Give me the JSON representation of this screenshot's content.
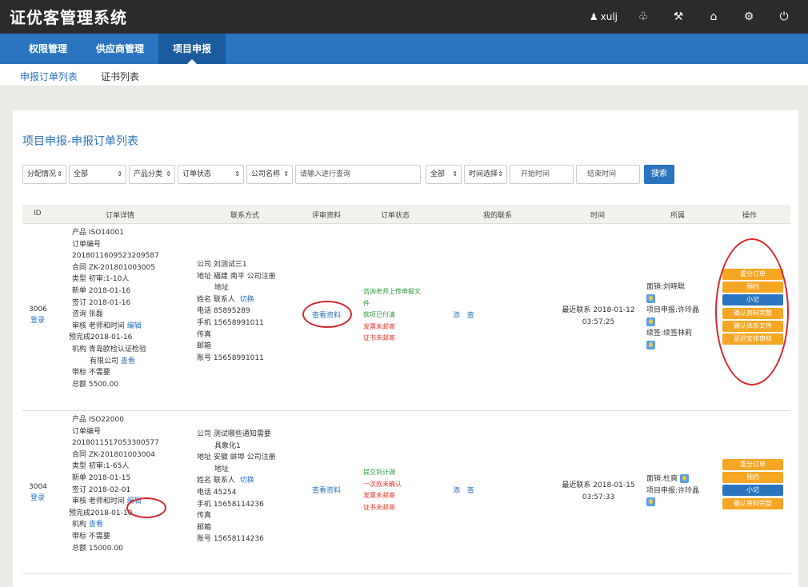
{
  "app": {
    "title": "证优客管理系统",
    "username": "xulj"
  },
  "topicons": [
    "bell-icon",
    "wrench-icon",
    "home-icon",
    "gear-icon",
    "power-icon"
  ],
  "nav": {
    "items": [
      "权限管理",
      "供应商管理",
      "项目申报"
    ],
    "active_index": 2
  },
  "subnav": {
    "items": [
      "申报订单列表",
      "证书列表"
    ],
    "active_index": 0
  },
  "page_title": "项目申报-申报订单列表",
  "filters": {
    "assign": "分配情况",
    "assign_value": "全部",
    "category": "产品分类",
    "order_status": "订单状态",
    "company_name": "公司名称",
    "search_placeholder": "请输入进行查询",
    "scope_value": "全部",
    "time_select": "时间选择",
    "start_time": "开始时间",
    "end_time": "结束时间",
    "search_button": "搜索"
  },
  "table": {
    "headers": [
      "ID",
      "订单详情",
      "联系方式",
      "评审资料",
      "订单状态",
      "我的联系",
      "时间",
      "所属",
      "操作"
    ],
    "rows": [
      {
        "id": "3006",
        "login": "登录",
        "details": {
          "product": "产品 ISO14001",
          "order_no_label": "订单编号",
          "order_no": "2018011609523209587",
          "contract": "合同 ZK-201801003005",
          "type": "类型 初审:1-10人",
          "new": "新单 2018-01-16",
          "signed": "签订 2018-01-16",
          "consult": "咨询 张磊",
          "review": "审核 老师和时间",
          "review_edit": "编辑",
          "predone": "预完成2018-01-16",
          "org": "机构 青岛欧检认证检验",
          "org2": "有限公司",
          "org_view": "查看",
          "bid": "带标 不需要",
          "total": "总额 5500.00"
        },
        "contact": {
          "company": "公司 刘测试三1",
          "address": "地址 福建 南平 公司注册",
          "address2": "地址",
          "name": "姓名 联系人",
          "switch": "切换",
          "phone": "电话 85895289",
          "mobile": "手机 15658991011",
          "fax": "传真",
          "email": "邮箱",
          "account": "账号 15658991011"
        },
        "review_link": "查看资料",
        "status": [
          {
            "text": "咨询老师上传申报文件",
            "color": "green"
          },
          {
            "text": "款项已付清",
            "color": "green"
          },
          {
            "text": "发票未邮寄",
            "color": "red"
          },
          {
            "text": "证书未邮寄",
            "color": "red"
          }
        ],
        "status_line1": "咨询老师上传申报文",
        "status_line1b": "件",
        "my_contact": {
          "add": "添",
          "view": "查"
        },
        "time": {
          "line1": "最近联系 2018-01-12",
          "line2": "03:57:25"
        },
        "owner": {
          "sales": "面销:刘晓聪",
          "project": "项目申报:许玲晶",
          "renew": "续签:续签林莉"
        },
        "ops": [
          {
            "label": "重分订单",
            "color": "orange"
          },
          {
            "label": "预约",
            "color": "orange"
          },
          {
            "label": "小记",
            "color": "blue"
          },
          {
            "label": "确认资料完整",
            "color": "orange"
          },
          {
            "label": "确认体系文件",
            "color": "orange"
          },
          {
            "label": "延迟安排审核",
            "color": "orange"
          }
        ]
      },
      {
        "id": "3004",
        "login": "登录",
        "details": {
          "product": "产品 ISO22000",
          "order_no_label": "订单编号",
          "order_no": "2018011517053300577",
          "contract": "合同 ZK-201801003004",
          "type": "类型 初审:1-65人",
          "new": "新单 2018-01-15",
          "signed": "签订 2018-02-01",
          "review": "审核 老师和时间",
          "review_edit": "编辑",
          "predone": "预完成2018-01-10",
          "org": "机构",
          "org_view": "查看",
          "bid": "带标 不需要",
          "total": "总额 15000.00"
        },
        "contact": {
          "company": "公司 测试哪些通知需要",
          "company2": "具象化1",
          "address": "地址 安徽 蚌埠 公司注册",
          "address2": "地址",
          "name": "姓名 联系人",
          "switch": "切换",
          "phone": "电话 45254",
          "mobile": "手机 15658114236",
          "fax": "传真",
          "email": "邮箱",
          "account": "账号 15658114236"
        },
        "review_link": "查看资料",
        "status": [
          {
            "text": "提交到计调",
            "color": "green"
          },
          {
            "text": "一次款未确认",
            "color": "red"
          },
          {
            "text": "发票未邮寄",
            "color": "red"
          },
          {
            "text": "证书未邮寄",
            "color": "red"
          }
        ],
        "my_contact": {
          "add": "添",
          "view": "查"
        },
        "time": {
          "line1": "最近联系 2018-01-15",
          "line2": "03:57:33"
        },
        "owner": {
          "sales": "面销:杜爽",
          "project": "项目申报:许玲晶"
        },
        "ops": [
          {
            "label": "重分订单",
            "color": "orange"
          },
          {
            "label": "预约",
            "color": "orange"
          },
          {
            "label": "小记",
            "color": "blue"
          },
          {
            "label": "确认资料完整",
            "color": "orange"
          }
        ]
      }
    ]
  },
  "colors": {
    "topbar": "#2b2b2e",
    "nav": "#2b74bf",
    "accent": "#2b74bf",
    "orange": "#f5a623",
    "annotation": "#d8262d"
  }
}
